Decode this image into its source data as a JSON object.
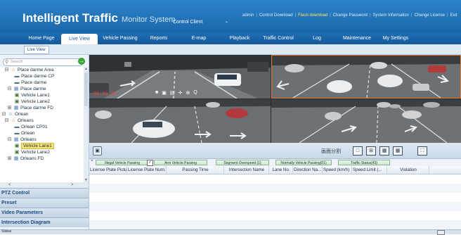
{
  "header": {
    "title": "Intelligent Traffic",
    "subtitle": "Monitor System",
    "client": "Control Client",
    "links": [
      "admin",
      "Control Download",
      "Flash download",
      "Change Password",
      "System Information",
      "Change License",
      "Exit"
    ],
    "highlight_link_color": "#ffe65c",
    "bg_color": "#1a67ad"
  },
  "nav": {
    "tabs": [
      "Home Page",
      "Live View",
      "Vehicle Passing",
      "Reports",
      "E-map",
      "Playback",
      "Traffic Control",
      "Log",
      "Maintenance",
      "My Settings"
    ],
    "active_tab": "Live View"
  },
  "subnav": {
    "tab": "Live View"
  },
  "sidebar": {
    "search_placeholder": "Search",
    "tree": [
      {
        "label": "Place darme Area",
        "icon": "area-icon",
        "toggle": "minus"
      },
      {
        "label": "Place darme CP",
        "icon": "camera-icon"
      },
      {
        "label": "Place darme",
        "icon": "camera-icon"
      },
      {
        "label": "Place darme",
        "icon": "group-icon",
        "toggle": "minus"
      },
      {
        "label": "Vehicle Lane1",
        "icon": "lane-icon"
      },
      {
        "label": "Vehicle Lane2",
        "icon": "lane-icon"
      },
      {
        "label": "Place darme FD",
        "icon": "group-icon",
        "toggle": "plus"
      },
      {
        "label": "Orlean",
        "icon": "user-icon",
        "toggle": "minus"
      },
      {
        "label": "Orleans",
        "icon": "area-icon",
        "toggle": "minus"
      },
      {
        "label": "Orlean CP01",
        "icon": "camera-icon"
      },
      {
        "label": "Orlean",
        "icon": "camera-icon"
      },
      {
        "label": "Orleans",
        "icon": "group-icon",
        "toggle": "minus"
      },
      {
        "label": "Vehicle Lane1",
        "icon": "lane-icon",
        "selected": true
      },
      {
        "label": "Vehicle Lane2",
        "icon": "lane-icon"
      },
      {
        "label": "Orleans FD",
        "icon": "group-icon",
        "toggle": "plus"
      }
    ],
    "panels": [
      "PTZ Control",
      "Preset",
      "Video Parameters",
      "Intersection Diagram"
    ]
  },
  "video": {
    "timestamp": "00:01:07",
    "split_label": "画面分割"
  },
  "record_tabs": [
    {
      "label": "Illegal Vehicle Passing",
      "has_close": true,
      "checked": true
    },
    {
      "label": "Arm Vehicle Passing"
    },
    {
      "label": "Segment Overspeed (1)"
    },
    {
      "label": "Normally Vehicle Passing(51)"
    },
    {
      "label": "Traffic Status(43)"
    }
  ],
  "table": {
    "columns": [
      "License Plate Pictu...",
      "License Plate Num...",
      "Passing Time",
      "Intersection Name",
      "Lane No.",
      "Direction Na...",
      "Speed (km/h)",
      "Speed Limit (...",
      "Violation"
    ],
    "rows": []
  },
  "statusbar": {
    "text": "Status"
  }
}
